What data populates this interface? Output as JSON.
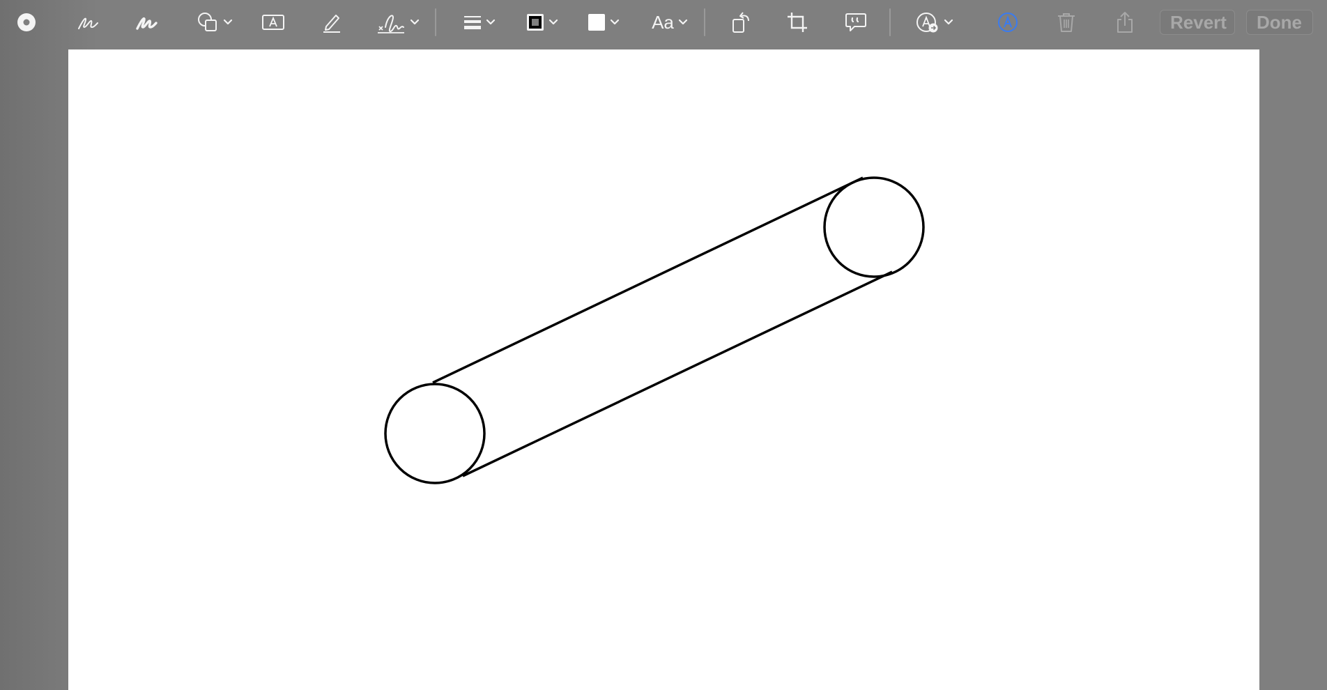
{
  "toolbar": {
    "tools": [
      {
        "name": "markup-mode-icon"
      },
      {
        "name": "sketch-icon"
      },
      {
        "name": "draw-icon"
      },
      {
        "name": "shapes-icon"
      },
      {
        "name": "text-box-icon"
      },
      {
        "name": "highlight-icon"
      },
      {
        "name": "signature-icon"
      },
      {
        "name": "line-style-icon"
      },
      {
        "name": "border-color-icon"
      },
      {
        "name": "fill-color-icon"
      },
      {
        "name": "text-style-icon"
      },
      {
        "name": "rotate-icon"
      },
      {
        "name": "crop-icon"
      },
      {
        "name": "description-icon"
      },
      {
        "name": "auto-fill-icon"
      },
      {
        "name": "accessibility-icon"
      },
      {
        "name": "trash-icon"
      },
      {
        "name": "share-icon"
      }
    ],
    "text_style_label": "Aa",
    "revert_label": "Revert",
    "done_label": "Done"
  },
  "colors": {
    "toolbar_bg": "#7f7f7f",
    "icon": "#f4f4f4",
    "accent": "#3a7bf0",
    "disabled": "#a8a8a8",
    "canvas": "#ffffff",
    "stroke": "#000000"
  },
  "drawing": {
    "shapes": [
      "circle",
      "circle",
      "line",
      "line"
    ],
    "description": ""
  }
}
